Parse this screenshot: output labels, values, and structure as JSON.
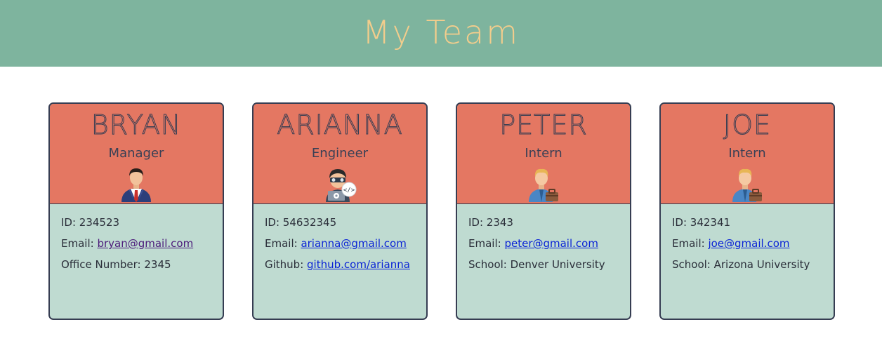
{
  "header": {
    "title": "My Team"
  },
  "colors": {
    "banner": "#7eb49e",
    "title": "#f3cd8c",
    "card_head": "#e47762",
    "card_body": "#bfdbd1",
    "border": "#363d52",
    "link": "#0a23d6",
    "link_visited": "#4b1a7a"
  },
  "cards": [
    {
      "name": "BRYAN",
      "role": "Manager",
      "icon": "manager-icon",
      "id_label": "ID: 234523",
      "email_label": "Email: ",
      "email": "bryan@gmail.com",
      "extra_label": "Office Number: 2345"
    },
    {
      "name": "ARIANNA",
      "role": "Engineer",
      "icon": "engineer-icon",
      "id_label": "ID: 54632345",
      "email_label": "Email: ",
      "email": "arianna@gmail.com",
      "extra_prefix": "Github: ",
      "extra_link": "github.com/arianna"
    },
    {
      "name": "PETER",
      "role": "Intern",
      "icon": "intern-icon",
      "id_label": "ID: 2343",
      "email_label": "Email: ",
      "email": "peter@gmail.com",
      "extra_label": "School: Denver University"
    },
    {
      "name": "JOE",
      "role": "Intern",
      "icon": "intern-icon",
      "id_label": "ID: 342341",
      "email_label": "Email: ",
      "email": "joe@gmail.com",
      "extra_label": "School: Arizona University"
    }
  ]
}
